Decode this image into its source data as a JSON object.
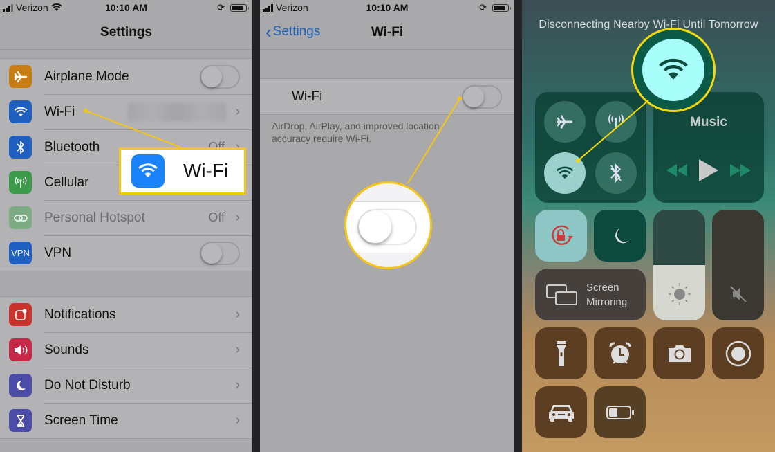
{
  "status_bar": {
    "carrier": "Verizon",
    "time": "10:10 AM"
  },
  "panel1": {
    "title": "Settings",
    "group1": [
      {
        "label": "Airplane Mode",
        "icon": "airplane-icon",
        "color": "#c87d12",
        "control": "toggle",
        "state": "off"
      },
      {
        "label": "Wi-Fi",
        "icon": "wifi-icon",
        "color": "#1f5fbf",
        "control": "chevron",
        "value": ""
      },
      {
        "label": "Bluetooth",
        "icon": "bluetooth-icon",
        "color": "#1f5fbf",
        "control": "chevron",
        "value": "Off"
      },
      {
        "label": "Cellular",
        "icon": "cellular-icon",
        "color": "#3b9b4a",
        "control": "chevron",
        "value": ""
      },
      {
        "label": "Personal Hotspot",
        "icon": "hotspot-icon",
        "color": "#7cab84",
        "control": "chevron",
        "value": "Off"
      },
      {
        "label": "VPN",
        "icon": "vpn-icon",
        "icon_text": "VPN",
        "color": "#1f5fbf",
        "control": "toggle",
        "state": "off"
      }
    ],
    "group2": [
      {
        "label": "Notifications",
        "icon": "notifications-icon",
        "color": "#c8332b"
      },
      {
        "label": "Sounds",
        "icon": "sounds-icon",
        "color": "#c82848"
      },
      {
        "label": "Do Not Disturb",
        "icon": "moon-icon",
        "color": "#4b4ba8"
      },
      {
        "label": "Screen Time",
        "icon": "hourglass-icon",
        "color": "#4b4ba8"
      }
    ],
    "callout": {
      "label": "Wi-Fi",
      "color": "#1a82fb"
    }
  },
  "panel2": {
    "back_label": "Settings",
    "title": "Wi-Fi",
    "wifi_row_label": "Wi-Fi",
    "wifi_state": "off",
    "footnote": "AirDrop, AirPlay, and improved location accuracy require Wi-Fi."
  },
  "panel3": {
    "banner": "Disconnecting Nearby Wi-Fi Until Tomorrow",
    "music_title": "Music",
    "brightness_level": 0.5,
    "volume_level": 0,
    "screen_mirroring_label_1": "Screen",
    "screen_mirroring_label_2": "Mirroring",
    "callout_color": "#f5d90f"
  }
}
